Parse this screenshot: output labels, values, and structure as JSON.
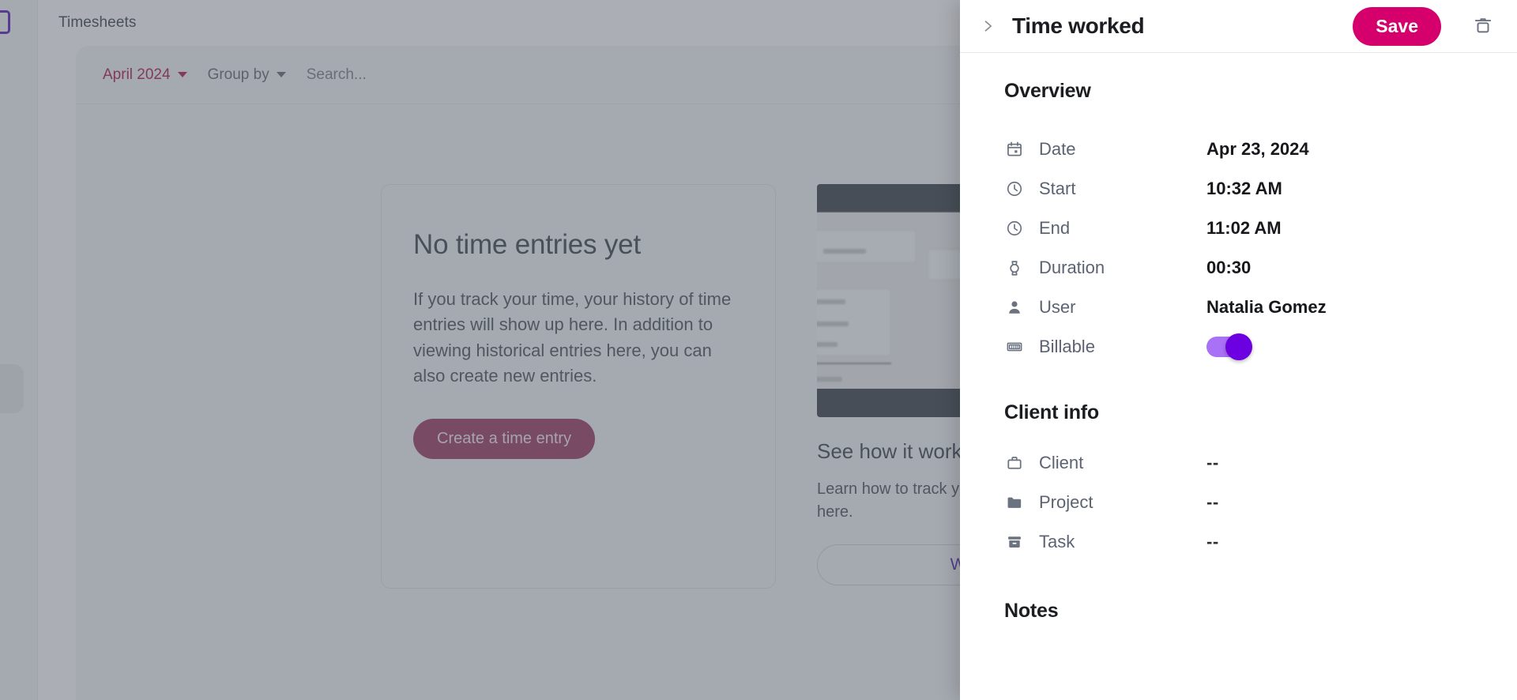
{
  "background": {
    "logo_icon": "app-logo-icon",
    "topbar": {
      "title": "Timesheets"
    },
    "filters": {
      "month_label": "April 2024",
      "group_by_label": "Group by",
      "search_placeholder": "Search..."
    },
    "empty_state": {
      "title": "No time entries yet",
      "body": "If you track your time, your history of time entries will show up here. In addition to viewing historical entries here, you can also create new entries.",
      "button_label": "Create a time entry"
    },
    "promo": {
      "title": "See how it works",
      "body": "Learn how to track your time and add those time entries here.",
      "button_label": "Watch the tutorial"
    }
  },
  "drawer": {
    "collapse_icon": "chevron-right-icon",
    "title": "Time worked",
    "save_label": "Save",
    "delete_icon": "trash-icon",
    "overview": {
      "heading": "Overview",
      "fields": [
        {
          "icon": "calendar-icon",
          "label": "Date",
          "value": "Apr 23, 2024"
        },
        {
          "icon": "clock-icon",
          "label": "Start",
          "value": "10:32 AM"
        },
        {
          "icon": "clock-icon",
          "label": "End",
          "value": "11:02 AM"
        },
        {
          "icon": "stopwatch-icon",
          "label": "Duration",
          "value": "00:30"
        },
        {
          "icon": "person-icon",
          "label": "User",
          "value": "Natalia Gomez"
        },
        {
          "icon": "money-icon",
          "label": "Billable",
          "value": "on"
        }
      ]
    },
    "client_info": {
      "heading": "Client info",
      "fields": [
        {
          "icon": "briefcase-icon",
          "label": "Client",
          "value": "--"
        },
        {
          "icon": "folder-icon",
          "label": "Project",
          "value": "--"
        },
        {
          "icon": "archive-icon",
          "label": "Task",
          "value": "--"
        }
      ]
    },
    "notes": {
      "heading": "Notes"
    }
  },
  "colors": {
    "save_button": "#d6006d",
    "toggle_track": "#a971f5",
    "toggle_knob": "#6c00e0",
    "accent_link": "#6f48c9",
    "month_filter": "#c43f6b"
  }
}
